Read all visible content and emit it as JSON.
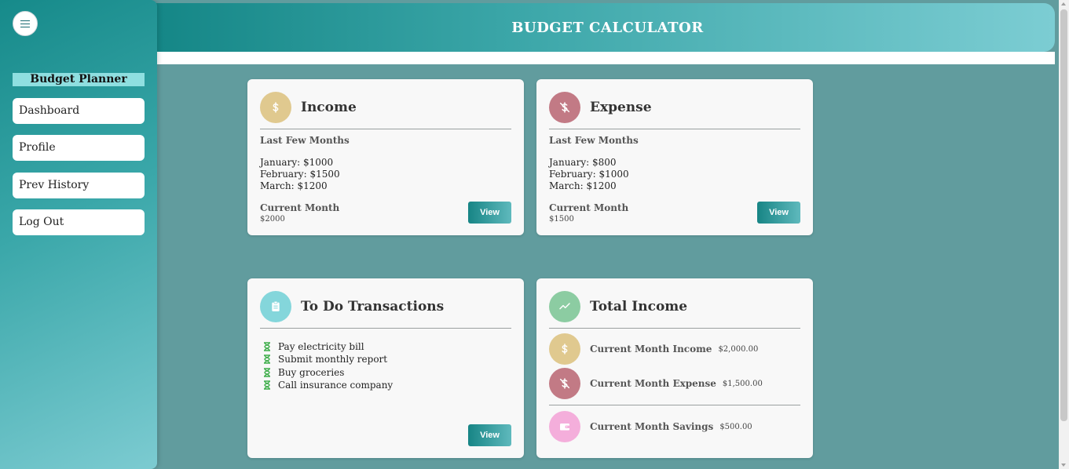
{
  "app": {
    "title": "BUDGET CALCULATOR"
  },
  "sidebar": {
    "brand": "Budget Planner",
    "items": [
      {
        "label": "Dashboard"
      },
      {
        "label": "Profile"
      },
      {
        "label": "Prev History"
      },
      {
        "label": "Log Out"
      }
    ]
  },
  "cards": {
    "income": {
      "title": "Income",
      "icon": "dollar-icon",
      "subtitle": "Last Few Months",
      "months": [
        "January: $1000",
        "February: $1500",
        "March: $1200"
      ],
      "current_label": "Current Month",
      "current_value": "$2000",
      "button": "View"
    },
    "expense": {
      "title": "Expense",
      "icon": "dollar-off-icon",
      "subtitle": "Last Few Months",
      "months": [
        "January: $800",
        "February: $1000",
        "March: $1200"
      ],
      "current_label": "Current Month",
      "current_value": "$1500",
      "button": "View"
    },
    "todo": {
      "title": "To Do Transactions",
      "icon": "clipboard-icon",
      "items": [
        "Pay electricity bill",
        "Submit monthly report",
        "Buy groceries",
        "Call insurance company"
      ],
      "item_icon": "hourglass-icon",
      "button": "View"
    },
    "total": {
      "title": "Total Income",
      "icon": "trend-icon",
      "rows": [
        {
          "label": "Current Month Income",
          "value": "$2,000.00",
          "icon": "dollar-icon"
        },
        {
          "label": "Current Month Expense",
          "value": "$1,500.00",
          "icon": "dollar-off-icon"
        },
        {
          "label": "Current Month Savings",
          "value": "$500.00",
          "icon": "wallet-icon"
        }
      ]
    }
  },
  "colors": {
    "background": "#619c9e",
    "accent": "#178585",
    "income_icon": "#e0c98f",
    "expense_icon": "#c27a85",
    "todo_icon": "#84d6db",
    "trend_icon": "#8ccca2",
    "savings_icon": "#f4aedb",
    "hourglass": "#3fae4b"
  }
}
